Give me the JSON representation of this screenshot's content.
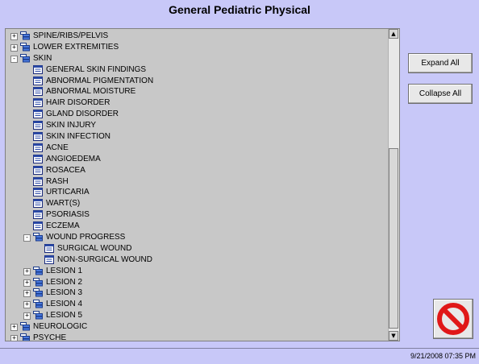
{
  "window": {
    "title": "General Pediatric Physical"
  },
  "tree": {
    "items": [
      {
        "label": "SPINE/RIBS/PELVIS",
        "level": 0,
        "type": "folder",
        "toggle": "+"
      },
      {
        "label": "LOWER EXTREMITIES",
        "level": 0,
        "type": "folder",
        "toggle": "+"
      },
      {
        "label": "SKIN",
        "level": 0,
        "type": "folder",
        "toggle": "-"
      },
      {
        "label": "GENERAL SKIN FINDINGS",
        "level": 1,
        "type": "doc",
        "toggle": ""
      },
      {
        "label": "ABNORMAL PIGMENTATION",
        "level": 1,
        "type": "doc",
        "toggle": ""
      },
      {
        "label": "ABNORMAL MOISTURE",
        "level": 1,
        "type": "doc",
        "toggle": ""
      },
      {
        "label": "HAIR DISORDER",
        "level": 1,
        "type": "doc",
        "toggle": ""
      },
      {
        "label": "GLAND DISORDER",
        "level": 1,
        "type": "doc",
        "toggle": ""
      },
      {
        "label": "SKIN INJURY",
        "level": 1,
        "type": "doc",
        "toggle": ""
      },
      {
        "label": "SKIN INFECTION",
        "level": 1,
        "type": "doc",
        "toggle": ""
      },
      {
        "label": "ACNE",
        "level": 1,
        "type": "doc",
        "toggle": ""
      },
      {
        "label": "ANGIOEDEMA",
        "level": 1,
        "type": "doc",
        "toggle": ""
      },
      {
        "label": "ROSACEA",
        "level": 1,
        "type": "doc",
        "toggle": ""
      },
      {
        "label": "RASH",
        "level": 1,
        "type": "doc",
        "toggle": ""
      },
      {
        "label": "URTICARIA",
        "level": 1,
        "type": "doc",
        "toggle": ""
      },
      {
        "label": "WART(S)",
        "level": 1,
        "type": "doc",
        "toggle": ""
      },
      {
        "label": "PSORIASIS",
        "level": 1,
        "type": "doc",
        "toggle": ""
      },
      {
        "label": "ECZEMA",
        "level": 1,
        "type": "doc",
        "toggle": ""
      },
      {
        "label": "WOUND PROGRESS",
        "level": 1,
        "type": "folder",
        "toggle": "-"
      },
      {
        "label": "SURGICAL WOUND",
        "level": 2,
        "type": "doc",
        "toggle": ""
      },
      {
        "label": "NON-SURGICAL WOUND",
        "level": 2,
        "type": "doc",
        "toggle": ""
      },
      {
        "label": "LESION 1",
        "level": 1,
        "type": "folder",
        "toggle": "+"
      },
      {
        "label": "LESION 2",
        "level": 1,
        "type": "folder",
        "toggle": "+"
      },
      {
        "label": "LESION 3",
        "level": 1,
        "type": "folder",
        "toggle": "+"
      },
      {
        "label": "LESION 4",
        "level": 1,
        "type": "folder",
        "toggle": "+"
      },
      {
        "label": "LESION 5",
        "level": 1,
        "type": "folder",
        "toggle": "+"
      },
      {
        "label": "NEUROLOGIC",
        "level": 0,
        "type": "folder",
        "toggle": "+"
      },
      {
        "label": "PSYCHE",
        "level": 0,
        "type": "folder",
        "toggle": "+"
      }
    ],
    "scroll_up": "▲",
    "scroll_down": "▼"
  },
  "buttons": {
    "expand_all": "Expand All",
    "collapse_all": "Collapse All",
    "cancel_icon": "no-symbol-icon"
  },
  "status": {
    "datetime": "9/21/2008  07:35 PM"
  },
  "colors": {
    "background": "#c8c8f8",
    "tree_background": "#c8c8c8",
    "cancel_red": "#e01818"
  }
}
